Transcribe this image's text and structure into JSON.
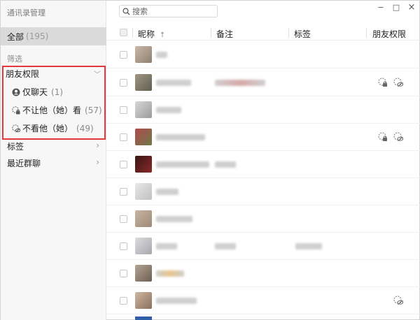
{
  "app": {
    "title": "通讯录管理"
  },
  "sidebar": {
    "all": {
      "label": "全部",
      "count": "(195)"
    },
    "filter_label": "筛选",
    "friend_perm": {
      "label": "朋友权限",
      "items": [
        {
          "label": "仅聊天",
          "count": "(1)"
        },
        {
          "label": "不让他（她）看",
          "count": "(57)"
        },
        {
          "label": "不看他（她）",
          "count": "(49)"
        }
      ]
    },
    "tags_label": "标签",
    "recent_groups_label": "最近群聊"
  },
  "search": {
    "placeholder": "搜索"
  },
  "window_controls": {
    "minimize": "−",
    "maximize": "□",
    "close": "×"
  },
  "table": {
    "columns": {
      "nickname": "昵称",
      "sort_icon": "↑",
      "remark": "备注",
      "tags": "标签",
      "friend_perm": "朋友权限"
    },
    "rows": [
      {
        "perm_icons": []
      },
      {
        "perm_icons": [
          "lock-icon",
          "eye-off-icon"
        ]
      },
      {
        "perm_icons": []
      },
      {
        "perm_icons": [
          "lock-icon",
          "eye-off-icon"
        ]
      },
      {
        "perm_icons": []
      },
      {
        "perm_icons": []
      },
      {
        "perm_icons": []
      },
      {
        "perm_icons": []
      },
      {
        "perm_icons": []
      },
      {
        "perm_icons": [
          "eye-off-icon"
        ]
      }
    ]
  },
  "colors": {
    "highlight_border": "#e5383c",
    "sidebar_bg": "#f7f7f7",
    "selected_bg": "#dadada"
  }
}
